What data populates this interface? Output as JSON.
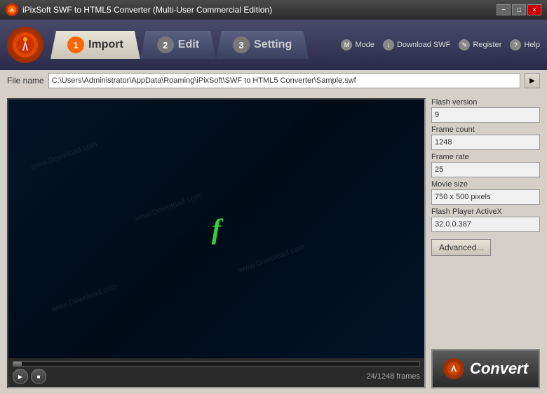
{
  "titlebar": {
    "title": "iPixSoft SWF to HTML5 Converter (Multi-User Commercial Edition)",
    "min_label": "−",
    "max_label": "□",
    "close_label": "×"
  },
  "tabs": [
    {
      "number": "1",
      "label": "Import",
      "active": true
    },
    {
      "number": "2",
      "label": "Edit",
      "active": false
    },
    {
      "number": "3",
      "label": "Setting",
      "active": false
    }
  ],
  "toolbar": {
    "mode_label": "Mode",
    "download_label": "Download SWF",
    "register_label": "Register",
    "help_label": "Help"
  },
  "file": {
    "label": "File name",
    "value": "C:\\Users\\Administrator\\AppData\\Roaming\\iPixSoft\\SWF to HTML5 Converter\\Sample.swf",
    "browse_icon": "▶"
  },
  "info": {
    "flash_version_label": "Flash version",
    "flash_version_value": "9",
    "frame_count_label": "Frame count",
    "frame_count_value": "1248",
    "frame_rate_label": "Frame rate",
    "frame_rate_value": "25",
    "movie_size_label": "Movie size",
    "movie_size_value": "750 x 500 pixels",
    "flash_player_label": "Flash Player ActiveX",
    "flash_player_value": "32.0.0.387",
    "advanced_btn_label": "Advanced..."
  },
  "preview": {
    "watermarks": [
      "www.Download.com",
      "www.Download.com",
      "www.Download.com",
      "www.Download.com"
    ],
    "flash_symbol": "f",
    "frame_info": "24/1248 frames",
    "play_icon": "▶",
    "stop_icon": "■"
  },
  "convert": {
    "label": "Convert"
  }
}
